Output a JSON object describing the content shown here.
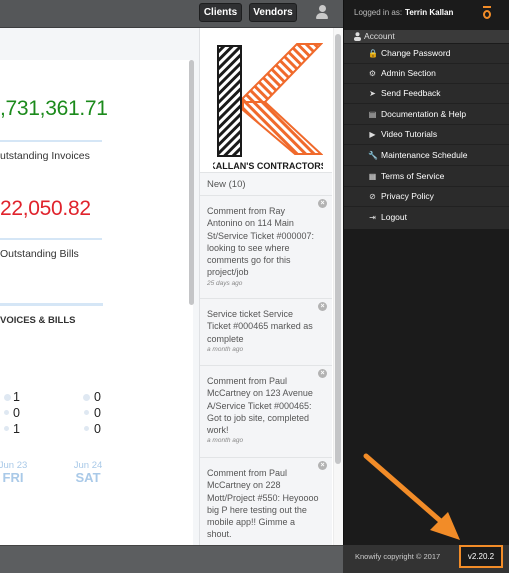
{
  "topbar": {
    "clients_label": "Clients",
    "vendors_label": "Vendors"
  },
  "dashboard": {
    "receivable_amount": ",731,361.71",
    "receivable_label": "utstanding Invoices",
    "payable_amount": "22,050.82",
    "payable_label": "Outstanding Bills",
    "section_title": "VOICES & BILLS",
    "stats_col1": [
      "1",
      "0",
      "1"
    ],
    "stats_col2": [
      "0",
      "0",
      "0"
    ],
    "days": [
      {
        "date": "Jun 23",
        "dow": "FRI"
      },
      {
        "date": "Jun 24",
        "dow": "SAT"
      }
    ]
  },
  "logo": {
    "text": "KALLAN'S CONTRACTORS"
  },
  "notifications": {
    "header": "New (10)",
    "close_glyph": "×",
    "items": [
      {
        "text": "Comment from Ray Antonino on 114 Main St/Service Ticket #000007: looking to see where comments go for this project/job",
        "ago": "25 days ago"
      },
      {
        "text": "Service ticket Service Ticket #000465 marked as complete",
        "ago": "a month ago"
      },
      {
        "text": "Comment from Paul McCartney on 123 Avenue A/Service Ticket #000465: Got to job site, completed work!",
        "ago": "a month ago"
      },
      {
        "text": "Comment from Paul McCartney on 228 Mott/Project #550: Heyoooo big P here testing out the mobile app!! Gimme a shout.",
        "ago": ""
      }
    ]
  },
  "account": {
    "logged_in_label": "Logged in as:",
    "user_name": "Terrin Kallan",
    "section_label": "Account",
    "menu": [
      {
        "label": "Change Password",
        "icon": "lock-icon",
        "glyph": "🔒"
      },
      {
        "label": "Admin Section",
        "icon": "cogs-icon",
        "glyph": "⚙"
      },
      {
        "label": "Send Feedback",
        "icon": "send-icon",
        "glyph": "➤"
      },
      {
        "label": "Documentation & Help",
        "icon": "book-icon",
        "glyph": "▤"
      },
      {
        "label": "Video Tutorials",
        "icon": "video-icon",
        "glyph": "▶"
      },
      {
        "label": "Maintenance Schedule",
        "icon": "wrench-icon",
        "glyph": "🔧"
      },
      {
        "label": "Terms of Service",
        "icon": "briefcase-icon",
        "glyph": "▦"
      },
      {
        "label": "Privacy Policy",
        "icon": "ban-icon",
        "glyph": "⊘"
      },
      {
        "label": "Logout",
        "icon": "sign-out-icon",
        "glyph": "⇥"
      }
    ]
  },
  "footer": {
    "copyright": "Knowify copyright © 2017",
    "version": "v2.20.2"
  },
  "colors": {
    "accent": "#f28c28",
    "positive": "#1b8a1b",
    "negative": "#e0232c",
    "dark_panel": "#1b1b1b"
  }
}
